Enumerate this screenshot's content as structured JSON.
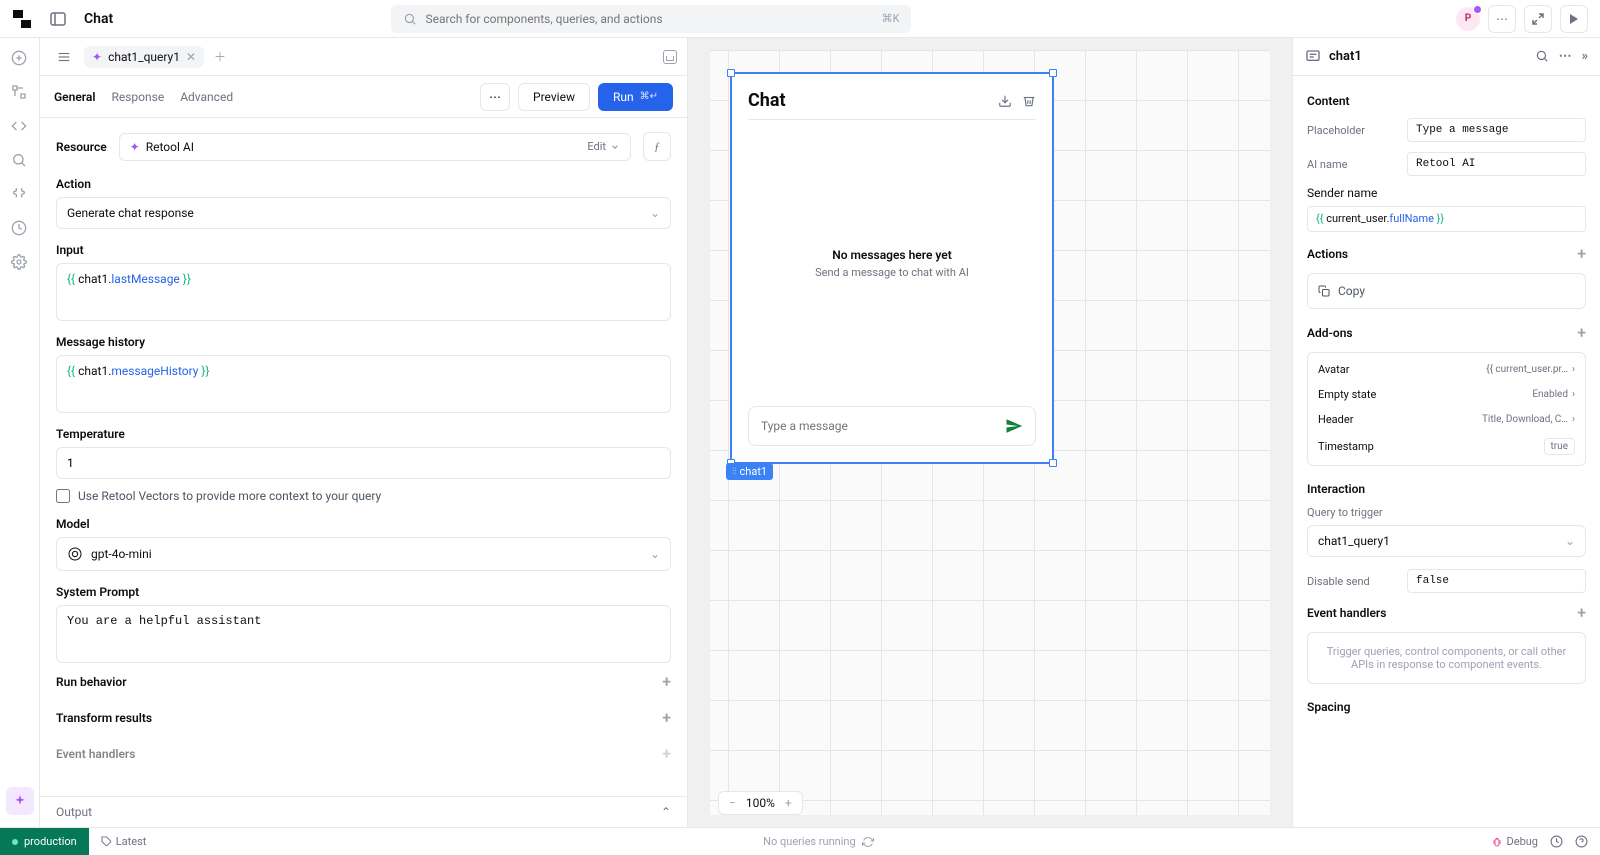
{
  "topbar": {
    "page_title": "Chat",
    "search_placeholder": "Search for components, queries, and actions",
    "kbd": "⌘K",
    "user_initial": "P"
  },
  "midpanel": {
    "tab_name": "chat1_query1",
    "tabs": {
      "general": "General",
      "response": "Response",
      "advanced": "Advanced"
    },
    "buttons": {
      "preview": "Preview",
      "run": "Run",
      "run_kbd": "⌘↵"
    },
    "resource": {
      "label": "Resource",
      "value": "Retool AI",
      "edit": "Edit"
    },
    "action": {
      "label": "Action",
      "value": "Generate chat response"
    },
    "input": {
      "label": "Input",
      "prefix": "{{ ",
      "var": "chat1",
      "dot": ".",
      "prop": "lastMessage",
      "suffix": " }}"
    },
    "history": {
      "label": "Message history",
      "prefix": "{{ ",
      "var": "chat1",
      "dot": ".",
      "prop": "messageHistory",
      "suffix": " }}"
    },
    "temperature": {
      "label": "Temperature",
      "value": "1"
    },
    "vectors_label": "Use Retool Vectors to provide more context to your query",
    "model": {
      "label": "Model",
      "value": "gpt-4o-mini"
    },
    "system_prompt": {
      "label": "System Prompt",
      "value": "You are a helpful assistant"
    },
    "run_behavior": "Run behavior",
    "transform_results": "Transform results",
    "event_handlers": "Event handlers",
    "output": "Output"
  },
  "canvas": {
    "chat_title": "Chat",
    "nomsg_title": "No messages here yet",
    "nomsg_sub": "Send a message to chat with AI",
    "input_placeholder": "Type a message",
    "component_label": "chat1",
    "zoom": "100%"
  },
  "rightpanel": {
    "title": "chat1",
    "content_section": "Content",
    "placeholder": {
      "label": "Placeholder",
      "value": "Type a message"
    },
    "ai_name": {
      "label": "AI name",
      "value": "Retool AI"
    },
    "sender_name_label": "Sender name",
    "sender_name_prefix": "{{ ",
    "sender_name_var": "current_user",
    "sender_name_dot": ".",
    "sender_name_prop": "fullName",
    "sender_name_suffix": " }}",
    "actions_section": "Actions",
    "action_copy": "Copy",
    "addons_section": "Add-ons",
    "addons": {
      "avatar": {
        "label": "Avatar",
        "value": "{{ current_user.pr…"
      },
      "empty_state": {
        "label": "Empty state",
        "value": "Enabled"
      },
      "header": {
        "label": "Header",
        "value": "Title, Download, C…"
      },
      "timestamp": {
        "label": "Timestamp",
        "value": "true"
      }
    },
    "interaction_section": "Interaction",
    "query_trigger": {
      "label": "Query to trigger",
      "value": "chat1_query1"
    },
    "disable_send": {
      "label": "Disable send",
      "value": "false"
    },
    "event_handlers_section": "Event handlers",
    "event_handlers_help": "Trigger queries, control components, or call other APIs in response to component events.",
    "spacing_section": "Spacing"
  },
  "footer": {
    "env": "production",
    "latest": "Latest",
    "queries": "No queries running",
    "debug": "Debug"
  }
}
